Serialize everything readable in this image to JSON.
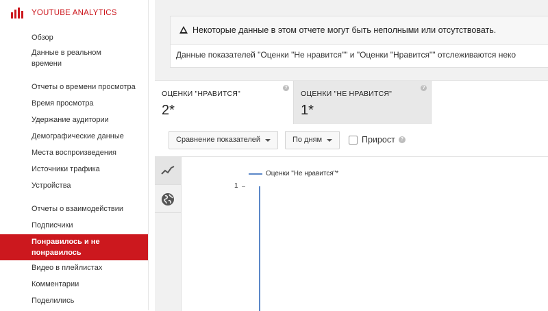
{
  "brand": {
    "title": "YOUTUBE ANALYTICS",
    "color": "#cc181e"
  },
  "sidebar": {
    "items": [
      {
        "label": "Обзор"
      },
      {
        "label": "Данные в реальном времени"
      },
      {
        "label": "Отчеты о времени просмотра"
      },
      {
        "label": "Время просмотра"
      },
      {
        "label": "Удержание аудитории"
      },
      {
        "label": "Демографические данные"
      },
      {
        "label": "Места воспроизведения"
      },
      {
        "label": "Источники трафика"
      },
      {
        "label": "Устройства"
      },
      {
        "label": "Отчеты о взаимодействии"
      },
      {
        "label": "Подписчики"
      },
      {
        "label": "Понравилось и не понравилось",
        "active": true
      },
      {
        "label": "Видео в плейлистах"
      },
      {
        "label": "Комментарии"
      },
      {
        "label": "Поделились"
      }
    ]
  },
  "warning": {
    "title": "Некоторые данные в этом отчете могут быть неполными или отсутствовать.",
    "body": "Данные показателей \"Оценки \"Не нравится\"\" и \"Оценки \"Нравится\"\" отслеживаются неко"
  },
  "metrics": [
    {
      "label": "ОЦЕНКИ \"НРАВИТСЯ\"",
      "value": "2*",
      "help": "?"
    },
    {
      "label": "ОЦЕНКИ \"НЕ НРАВИТСЯ\"",
      "value": "1*",
      "help": "?"
    }
  ],
  "toolbar": {
    "compare_label": "Сравнение показателей",
    "period_label": "По дням",
    "growth_label": "Прирост",
    "growth_checked": false,
    "help": "?"
  },
  "chart_tabs": [
    {
      "icon": "line-chart-icon",
      "active": true
    },
    {
      "icon": "globe-icon",
      "active": false
    }
  ],
  "chart_data": {
    "type": "line",
    "series": [
      {
        "name": "Оценки \"Не нравится\"*",
        "color": "#5b87c8"
      }
    ],
    "yticks": [
      "1"
    ]
  }
}
